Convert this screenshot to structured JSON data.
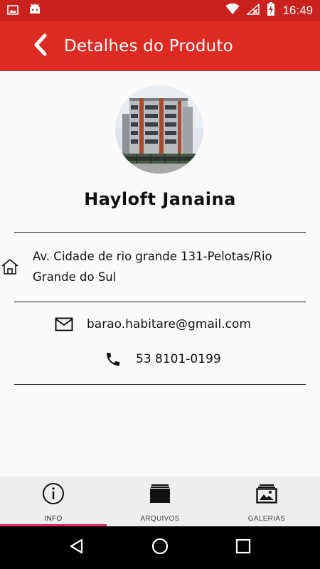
{
  "status_bar": {
    "time": "16:49",
    "icons": [
      "image-icon",
      "android-icon",
      "wifi-icon",
      "no-signal-icon",
      "battery-charging-icon"
    ]
  },
  "app_bar": {
    "title": "Detalhes do Produto",
    "back_icon": "chevron-left-icon",
    "color": "#dd2a22"
  },
  "product": {
    "name": "Hayloft Janaina",
    "image": "building-photo",
    "address": "Av. Cidade de rio grande 131-Pelotas/Rio Grande do Sul",
    "email": "barao.habitare@gmail.com",
    "phone": "53 8101-0199"
  },
  "tabs": [
    {
      "label": "INFO",
      "icon": "info-icon",
      "active": true
    },
    {
      "label": "ARQUIVOS",
      "icon": "folder-icon",
      "active": false
    },
    {
      "label": "GALERIAS",
      "icon": "gallery-icon",
      "active": false
    }
  ],
  "accent": "#e91e63",
  "nav": [
    "back-triangle-icon",
    "home-circle-icon",
    "recents-square-icon"
  ]
}
